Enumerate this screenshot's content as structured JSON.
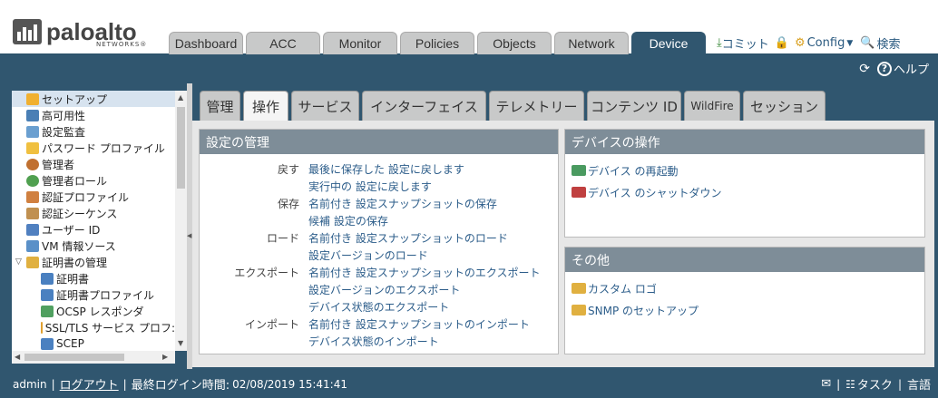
{
  "brand": {
    "name": "paloalto",
    "sub": "NETWORKS®"
  },
  "maintabs": [
    {
      "label": "Dashboard"
    },
    {
      "label": "ACC"
    },
    {
      "label": "Monitor"
    },
    {
      "label": "Policies"
    },
    {
      "label": "Objects"
    },
    {
      "label": "Network"
    },
    {
      "label": "Device"
    }
  ],
  "topright": {
    "commit": "コミット",
    "config": "Config",
    "search": "検索"
  },
  "helpbar": {
    "help": "ヘルプ"
  },
  "tree": [
    {
      "label": "セットアップ"
    },
    {
      "label": "高可用性"
    },
    {
      "label": "設定監査"
    },
    {
      "label": "パスワード プロファイル"
    },
    {
      "label": "管理者"
    },
    {
      "label": "管理者ロール"
    },
    {
      "label": "認証プロファイル"
    },
    {
      "label": "認証シーケンス"
    },
    {
      "label": "ユーザー ID"
    },
    {
      "label": "VM 情報ソース"
    },
    {
      "label": "証明書の管理"
    },
    {
      "label": "証明書"
    },
    {
      "label": "証明書プロファイル"
    },
    {
      "label": "OCSP レスポンダ"
    },
    {
      "label": "SSL/TLS サービス プロフ:"
    },
    {
      "label": "SCEP"
    }
  ],
  "subtabs": [
    {
      "label": "管理"
    },
    {
      "label": "操作"
    },
    {
      "label": "サービス"
    },
    {
      "label": "インターフェイス"
    },
    {
      "label": "テレメトリー"
    },
    {
      "label": "コンテンツ ID"
    },
    {
      "label": "WildFire"
    },
    {
      "label": "セッション"
    }
  ],
  "config_mgmt": {
    "title": "設定の管理",
    "rows": [
      {
        "label": "戻す",
        "link": "最後に保存した 設定に戻します"
      },
      {
        "label": "",
        "link": "実行中の 設定に戻します"
      },
      {
        "label": "保存",
        "link": "名前付き 設定スナップショットの保存"
      },
      {
        "label": "",
        "link": "候補 設定の保存"
      },
      {
        "label": "ロード",
        "link": "名前付き 設定スナップショットのロード"
      },
      {
        "label": "",
        "link": "設定バージョンのロード"
      },
      {
        "label": "エクスポート",
        "link": "名前付き 設定スナップショットのエクスポート"
      },
      {
        "label": "",
        "link": "設定バージョンのエクスポート"
      },
      {
        "label": "",
        "link": "デバイス状態のエクスポート"
      },
      {
        "label": "インポート",
        "link": "名前付き 設定スナップショットのインポート"
      },
      {
        "label": "",
        "link": "デバイス状態のインポート"
      }
    ]
  },
  "device_ops": {
    "title": "デバイスの操作",
    "items": [
      {
        "label": "デバイス の再起動"
      },
      {
        "label": "デバイス のシャットダウン"
      }
    ]
  },
  "misc": {
    "title": "その他",
    "items": [
      {
        "label": "カスタム ロゴ"
      },
      {
        "label": "SNMP のセットアップ"
      }
    ]
  },
  "footer": {
    "user": "admin",
    "logout": "ログアウト",
    "last_login_label": "最終ログイン時間:",
    "last_login_value": "02/08/2019 15:41:41",
    "tasks": "タスク",
    "language": "言語"
  },
  "colors": {
    "accent": "#30566f",
    "link": "#2c5d8a",
    "panel_header": "#7e8d98"
  }
}
